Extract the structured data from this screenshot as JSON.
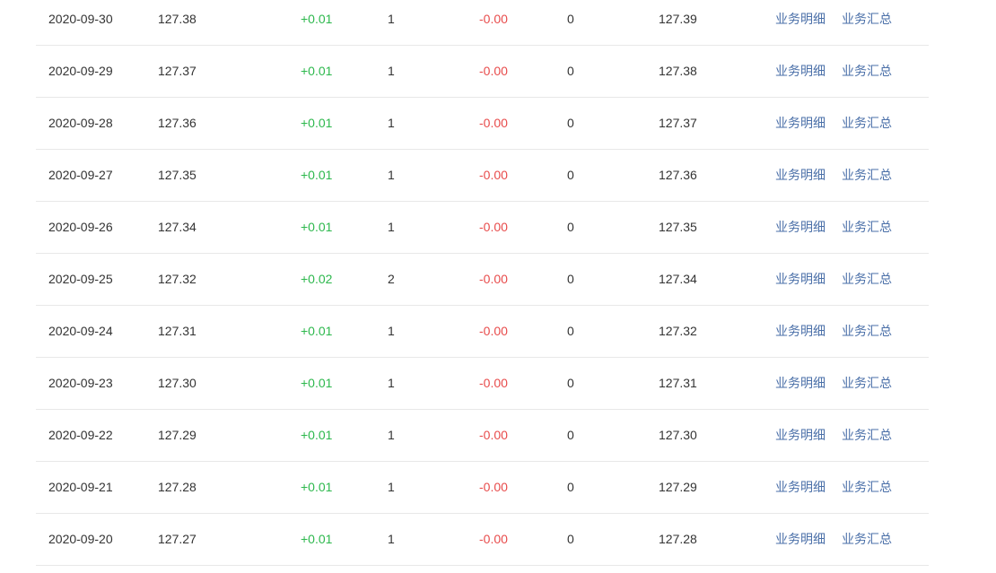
{
  "table": {
    "rows": [
      {
        "date": "2020-09-30",
        "value1": "127.38",
        "up": "+0.01",
        "count1": "1",
        "down": "-0.00",
        "count2": "0",
        "value2": "127.39",
        "link_detail": "业务明细",
        "link_summary": "业务汇总"
      },
      {
        "date": "2020-09-29",
        "value1": "127.37",
        "up": "+0.01",
        "count1": "1",
        "down": "-0.00",
        "count2": "0",
        "value2": "127.38",
        "link_detail": "业务明细",
        "link_summary": "业务汇总"
      },
      {
        "date": "2020-09-28",
        "value1": "127.36",
        "up": "+0.01",
        "count1": "1",
        "down": "-0.00",
        "count2": "0",
        "value2": "127.37",
        "link_detail": "业务明细",
        "link_summary": "业务汇总"
      },
      {
        "date": "2020-09-27",
        "value1": "127.35",
        "up": "+0.01",
        "count1": "1",
        "down": "-0.00",
        "count2": "0",
        "value2": "127.36",
        "link_detail": "业务明细",
        "link_summary": "业务汇总"
      },
      {
        "date": "2020-09-26",
        "value1": "127.34",
        "up": "+0.01",
        "count1": "1",
        "down": "-0.00",
        "count2": "0",
        "value2": "127.35",
        "link_detail": "业务明细",
        "link_summary": "业务汇总"
      },
      {
        "date": "2020-09-25",
        "value1": "127.32",
        "up": "+0.02",
        "count1": "2",
        "down": "-0.00",
        "count2": "0",
        "value2": "127.34",
        "link_detail": "业务明细",
        "link_summary": "业务汇总"
      },
      {
        "date": "2020-09-24",
        "value1": "127.31",
        "up": "+0.01",
        "count1": "1",
        "down": "-0.00",
        "count2": "0",
        "value2": "127.32",
        "link_detail": "业务明细",
        "link_summary": "业务汇总"
      },
      {
        "date": "2020-09-23",
        "value1": "127.30",
        "up": "+0.01",
        "count1": "1",
        "down": "-0.00",
        "count2": "0",
        "value2": "127.31",
        "link_detail": "业务明细",
        "link_summary": "业务汇总"
      },
      {
        "date": "2020-09-22",
        "value1": "127.29",
        "up": "+0.01",
        "count1": "1",
        "down": "-0.00",
        "count2": "0",
        "value2": "127.30",
        "link_detail": "业务明细",
        "link_summary": "业务汇总"
      },
      {
        "date": "2020-09-21",
        "value1": "127.28",
        "up": "+0.01",
        "count1": "1",
        "down": "-0.00",
        "count2": "0",
        "value2": "127.29",
        "link_detail": "业务明细",
        "link_summary": "业务汇总"
      },
      {
        "date": "2020-09-20",
        "value1": "127.27",
        "up": "+0.01",
        "count1": "1",
        "down": "-0.00",
        "count2": "0",
        "value2": "127.28",
        "link_detail": "业务明细",
        "link_summary": "业务汇总"
      }
    ]
  },
  "colors": {
    "increase": "#2db84d",
    "decrease": "#e84c4c",
    "link": "#4a6fa8",
    "divider": "#e8e8e8"
  }
}
